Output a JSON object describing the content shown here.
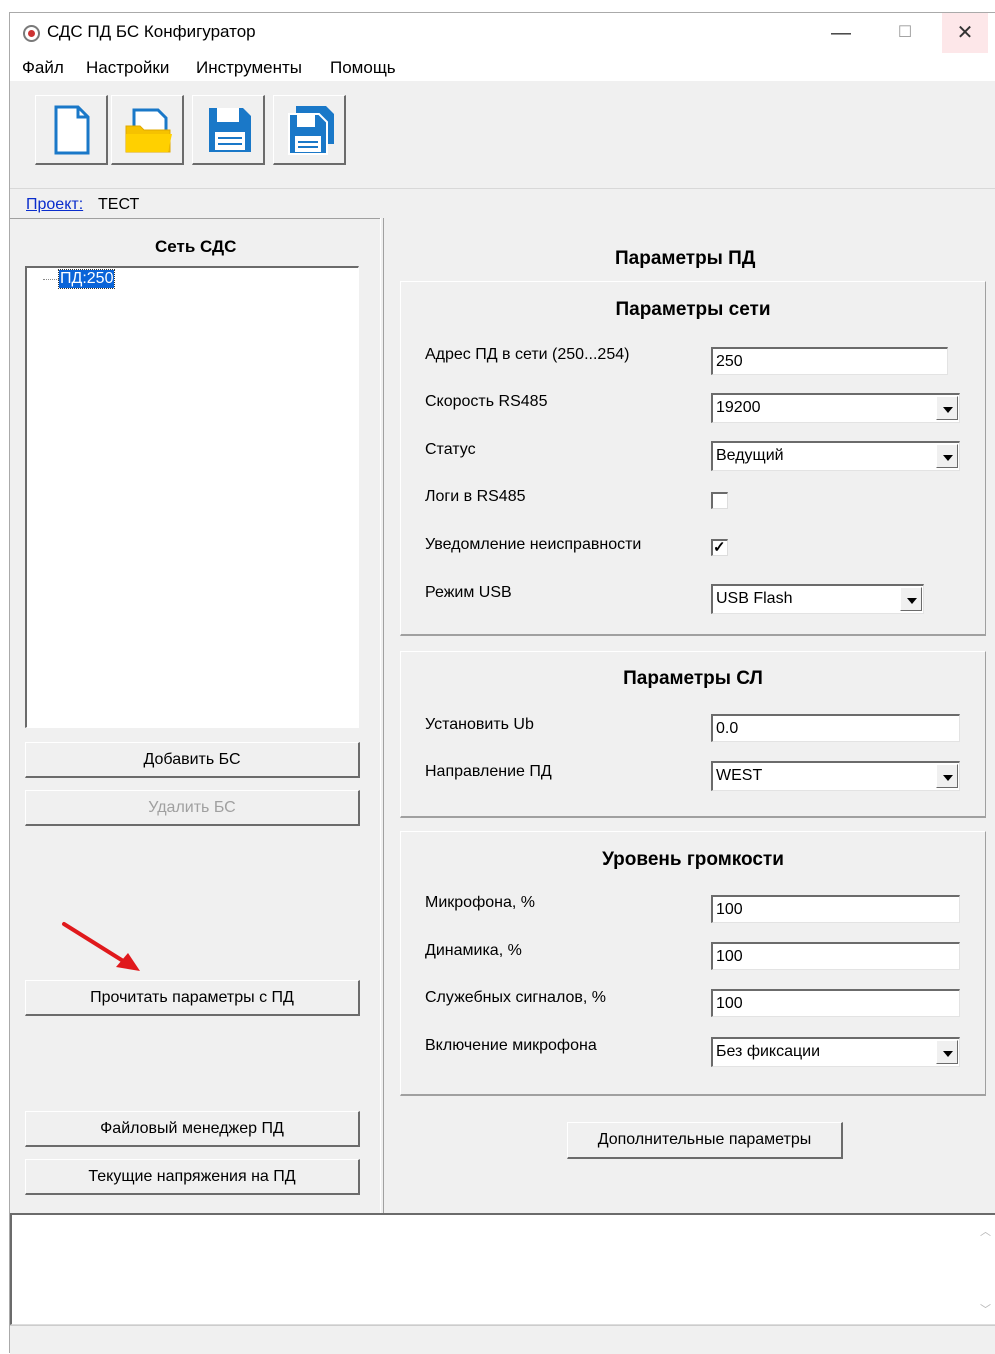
{
  "window": {
    "title": "СДС ПД БС Конфигуратор",
    "minimize": "—",
    "maximize": "☐",
    "close": "✕"
  },
  "menu": [
    "Файл",
    "Настройки",
    "Инструменты",
    "Помощь"
  ],
  "toolbar": {
    "buttons": [
      "new-file-icon",
      "open-folder-icon",
      "save-icon",
      "save-as-icon"
    ]
  },
  "project": {
    "label": "Проект:",
    "value": "ТЕСТ"
  },
  "left": {
    "title": "Сеть СДС",
    "tree": [
      "ПД:250"
    ],
    "add_bs": "Добавить БС",
    "remove_bs": "Удалить БС",
    "read_params": "Прочитать параметры с ПД",
    "file_manager": "Файловый менеджер ПД",
    "voltages": "Текущие напряжения на ПД"
  },
  "right": {
    "title": "Параметры ПД",
    "network": {
      "title": "Параметры сети",
      "address_label": "Адрес  ПД в сети (250...254)",
      "address_value": "250",
      "speed_label": "Скорость RS485",
      "speed_value": "19200",
      "status_label": "Статус",
      "status_value": "Ведущий",
      "logs_label": "Логи в RS485",
      "logs_checked": false,
      "fault_label": "Уведомление неисправности",
      "fault_checked": true,
      "usb_label": "Режим USB",
      "usb_value": "USB Flash"
    },
    "line": {
      "title": "Параметры СЛ",
      "ub_label": "Установить Ub",
      "ub_value": "0.0",
      "dir_label": "Направление ПД",
      "dir_value": "WEST"
    },
    "volume": {
      "title": "Уровень громкости",
      "mic_label": "Микрофона, %",
      "mic_value": "100",
      "spk_label": "Динамика, %",
      "spk_value": "100",
      "svc_label": "Служебных сигналов, %",
      "svc_value": "100",
      "micmode_label": "Включение микрофона",
      "micmode_value": "Без фиксации"
    },
    "extra_button": "Дополнительные параметры"
  },
  "colors": {
    "selection": "#0a64d8",
    "link": "#0a2dcc",
    "annotation_arrow": "#e0191c"
  }
}
